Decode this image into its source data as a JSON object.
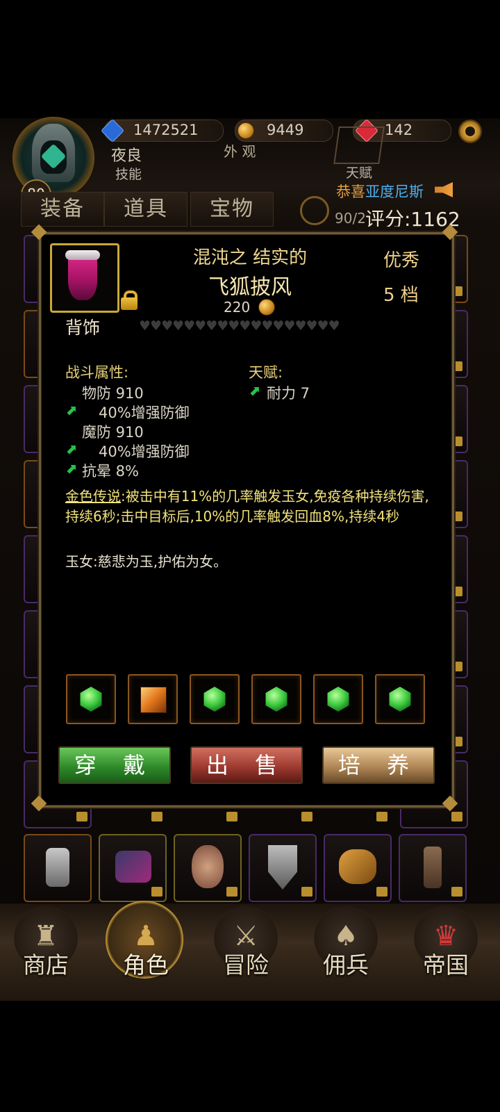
{
  "header": {
    "level": "80",
    "blue_currency": "1472521",
    "gold_currency": "9449",
    "red_currency": "142",
    "player_name": "夜良",
    "appearance_label": "外 观",
    "skills_label": "技能",
    "talent_label": "天赋",
    "notice_prefix": "恭喜",
    "notice_name": "亚度尼斯",
    "capacity": "90/2",
    "score": "评分:1162"
  },
  "tabs": [
    "装备",
    "道具",
    "宝物"
  ],
  "item": {
    "name_line1": "混沌之 结实的",
    "name_line2": "飞狐披风",
    "price": "220",
    "quality": "优秀",
    "tier": "5 档",
    "slot_type": "背饰",
    "hearts": "♥♥♥♥♥♥♥♥♥♥♥♥♥♥♥♥♥♥",
    "combat_title": "战斗属性:",
    "combat_stats": [
      {
        "text": "物防 910",
        "arrow": false
      },
      {
        "text": "40%增强防御",
        "arrow": true
      },
      {
        "text": "魔防 910",
        "arrow": false
      },
      {
        "text": "40%增强防御",
        "arrow": true
      },
      {
        "text": "抗晕 8%",
        "arrow": true
      }
    ],
    "talent_title": "天赋:",
    "talent_stat": "耐力 7",
    "legend_label": "金色传说",
    "legend_text": ":被击中有11%的几率触发玉女,免疫各种持续伤害,持续6秒;击中目标后,10%的几率触发回血8%,持续4秒",
    "lore": "玉女:慈悲为玉,护佑为女。",
    "sockets": [
      "green-gem-icon",
      "orange-gem-icon",
      "green-gem-icon",
      "green-gem-icon",
      "green-gem-icon",
      "green-gem-icon"
    ]
  },
  "buttons": {
    "wear": "穿 戴",
    "sell": "出 售",
    "train": "培 养"
  },
  "nav": [
    "商店",
    "角色",
    "冒险",
    "佣兵",
    "帝国"
  ]
}
